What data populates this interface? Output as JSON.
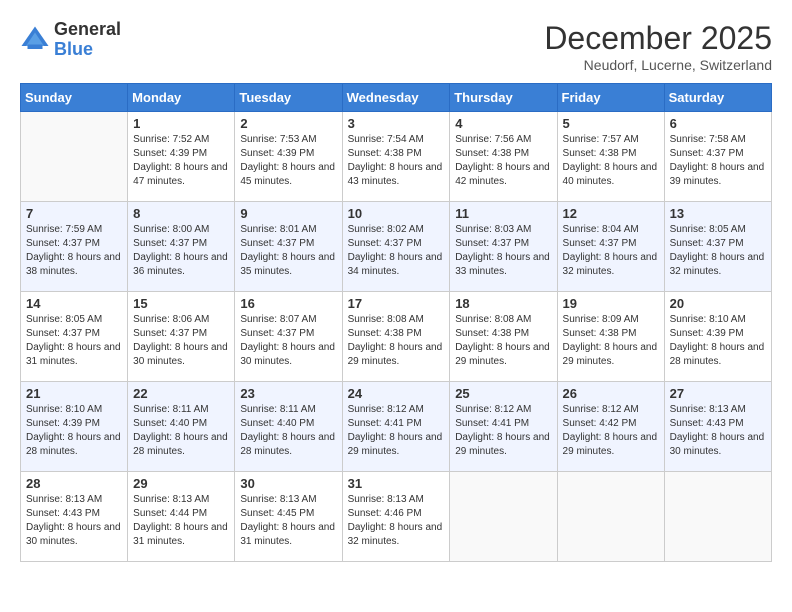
{
  "header": {
    "logo_line1": "General",
    "logo_line2": "Blue",
    "month": "December 2025",
    "location": "Neudorf, Lucerne, Switzerland"
  },
  "days_of_week": [
    "Sunday",
    "Monday",
    "Tuesday",
    "Wednesday",
    "Thursday",
    "Friday",
    "Saturday"
  ],
  "weeks": [
    [
      {
        "day": "",
        "sunrise": "",
        "sunset": "",
        "daylight": ""
      },
      {
        "day": "1",
        "sunrise": "Sunrise: 7:52 AM",
        "sunset": "Sunset: 4:39 PM",
        "daylight": "Daylight: 8 hours and 47 minutes."
      },
      {
        "day": "2",
        "sunrise": "Sunrise: 7:53 AM",
        "sunset": "Sunset: 4:39 PM",
        "daylight": "Daylight: 8 hours and 45 minutes."
      },
      {
        "day": "3",
        "sunrise": "Sunrise: 7:54 AM",
        "sunset": "Sunset: 4:38 PM",
        "daylight": "Daylight: 8 hours and 43 minutes."
      },
      {
        "day": "4",
        "sunrise": "Sunrise: 7:56 AM",
        "sunset": "Sunset: 4:38 PM",
        "daylight": "Daylight: 8 hours and 42 minutes."
      },
      {
        "day": "5",
        "sunrise": "Sunrise: 7:57 AM",
        "sunset": "Sunset: 4:38 PM",
        "daylight": "Daylight: 8 hours and 40 minutes."
      },
      {
        "day": "6",
        "sunrise": "Sunrise: 7:58 AM",
        "sunset": "Sunset: 4:37 PM",
        "daylight": "Daylight: 8 hours and 39 minutes."
      }
    ],
    [
      {
        "day": "7",
        "sunrise": "Sunrise: 7:59 AM",
        "sunset": "Sunset: 4:37 PM",
        "daylight": "Daylight: 8 hours and 38 minutes."
      },
      {
        "day": "8",
        "sunrise": "Sunrise: 8:00 AM",
        "sunset": "Sunset: 4:37 PM",
        "daylight": "Daylight: 8 hours and 36 minutes."
      },
      {
        "day": "9",
        "sunrise": "Sunrise: 8:01 AM",
        "sunset": "Sunset: 4:37 PM",
        "daylight": "Daylight: 8 hours and 35 minutes."
      },
      {
        "day": "10",
        "sunrise": "Sunrise: 8:02 AM",
        "sunset": "Sunset: 4:37 PM",
        "daylight": "Daylight: 8 hours and 34 minutes."
      },
      {
        "day": "11",
        "sunrise": "Sunrise: 8:03 AM",
        "sunset": "Sunset: 4:37 PM",
        "daylight": "Daylight: 8 hours and 33 minutes."
      },
      {
        "day": "12",
        "sunrise": "Sunrise: 8:04 AM",
        "sunset": "Sunset: 4:37 PM",
        "daylight": "Daylight: 8 hours and 32 minutes."
      },
      {
        "day": "13",
        "sunrise": "Sunrise: 8:05 AM",
        "sunset": "Sunset: 4:37 PM",
        "daylight": "Daylight: 8 hours and 32 minutes."
      }
    ],
    [
      {
        "day": "14",
        "sunrise": "Sunrise: 8:05 AM",
        "sunset": "Sunset: 4:37 PM",
        "daylight": "Daylight: 8 hours and 31 minutes."
      },
      {
        "day": "15",
        "sunrise": "Sunrise: 8:06 AM",
        "sunset": "Sunset: 4:37 PM",
        "daylight": "Daylight: 8 hours and 30 minutes."
      },
      {
        "day": "16",
        "sunrise": "Sunrise: 8:07 AM",
        "sunset": "Sunset: 4:37 PM",
        "daylight": "Daylight: 8 hours and 30 minutes."
      },
      {
        "day": "17",
        "sunrise": "Sunrise: 8:08 AM",
        "sunset": "Sunset: 4:38 PM",
        "daylight": "Daylight: 8 hours and 29 minutes."
      },
      {
        "day": "18",
        "sunrise": "Sunrise: 8:08 AM",
        "sunset": "Sunset: 4:38 PM",
        "daylight": "Daylight: 8 hours and 29 minutes."
      },
      {
        "day": "19",
        "sunrise": "Sunrise: 8:09 AM",
        "sunset": "Sunset: 4:38 PM",
        "daylight": "Daylight: 8 hours and 29 minutes."
      },
      {
        "day": "20",
        "sunrise": "Sunrise: 8:10 AM",
        "sunset": "Sunset: 4:39 PM",
        "daylight": "Daylight: 8 hours and 28 minutes."
      }
    ],
    [
      {
        "day": "21",
        "sunrise": "Sunrise: 8:10 AM",
        "sunset": "Sunset: 4:39 PM",
        "daylight": "Daylight: 8 hours and 28 minutes."
      },
      {
        "day": "22",
        "sunrise": "Sunrise: 8:11 AM",
        "sunset": "Sunset: 4:40 PM",
        "daylight": "Daylight: 8 hours and 28 minutes."
      },
      {
        "day": "23",
        "sunrise": "Sunrise: 8:11 AM",
        "sunset": "Sunset: 4:40 PM",
        "daylight": "Daylight: 8 hours and 28 minutes."
      },
      {
        "day": "24",
        "sunrise": "Sunrise: 8:12 AM",
        "sunset": "Sunset: 4:41 PM",
        "daylight": "Daylight: 8 hours and 29 minutes."
      },
      {
        "day": "25",
        "sunrise": "Sunrise: 8:12 AM",
        "sunset": "Sunset: 4:41 PM",
        "daylight": "Daylight: 8 hours and 29 minutes."
      },
      {
        "day": "26",
        "sunrise": "Sunrise: 8:12 AM",
        "sunset": "Sunset: 4:42 PM",
        "daylight": "Daylight: 8 hours and 29 minutes."
      },
      {
        "day": "27",
        "sunrise": "Sunrise: 8:13 AM",
        "sunset": "Sunset: 4:43 PM",
        "daylight": "Daylight: 8 hours and 30 minutes."
      }
    ],
    [
      {
        "day": "28",
        "sunrise": "Sunrise: 8:13 AM",
        "sunset": "Sunset: 4:43 PM",
        "daylight": "Daylight: 8 hours and 30 minutes."
      },
      {
        "day": "29",
        "sunrise": "Sunrise: 8:13 AM",
        "sunset": "Sunset: 4:44 PM",
        "daylight": "Daylight: 8 hours and 31 minutes."
      },
      {
        "day": "30",
        "sunrise": "Sunrise: 8:13 AM",
        "sunset": "Sunset: 4:45 PM",
        "daylight": "Daylight: 8 hours and 31 minutes."
      },
      {
        "day": "31",
        "sunrise": "Sunrise: 8:13 AM",
        "sunset": "Sunset: 4:46 PM",
        "daylight": "Daylight: 8 hours and 32 minutes."
      },
      {
        "day": "",
        "sunrise": "",
        "sunset": "",
        "daylight": ""
      },
      {
        "day": "",
        "sunrise": "",
        "sunset": "",
        "daylight": ""
      },
      {
        "day": "",
        "sunrise": "",
        "sunset": "",
        "daylight": ""
      }
    ]
  ],
  "accent_color": "#3a7fd5"
}
